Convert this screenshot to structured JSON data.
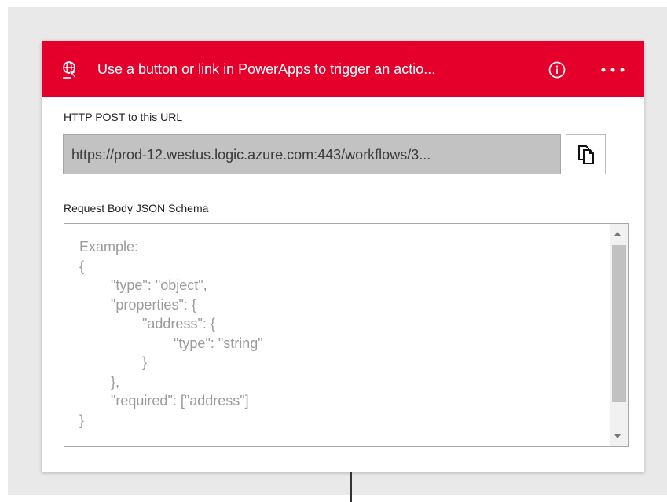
{
  "header": {
    "title": "Use a button or link in PowerApps to trigger an actio...",
    "background_color": "#e4002b",
    "trigger_icon": "globe-pointer-icon",
    "info_icon": "info-icon",
    "more_icon": "more-icon"
  },
  "http_post": {
    "label": "HTTP POST to this URL",
    "url": "https://prod-12.westus.logic.azure.com:443/workflows/3...",
    "copy_icon": "copy-icon"
  },
  "schema": {
    "label": "Request Body JSON Schema",
    "placeholder": "Example:\n{\n\t\"type\": \"object\",\n\t\"properties\": {\n\t\t\"address\": {\n\t\t\t\"type\": \"string\"\n\t\t}\n\t},\n\t\"required\": [\"address\"]\n}"
  },
  "colors": {
    "canvas_background": "#e9e9e9",
    "url_field_background": "#c2c2c2"
  }
}
